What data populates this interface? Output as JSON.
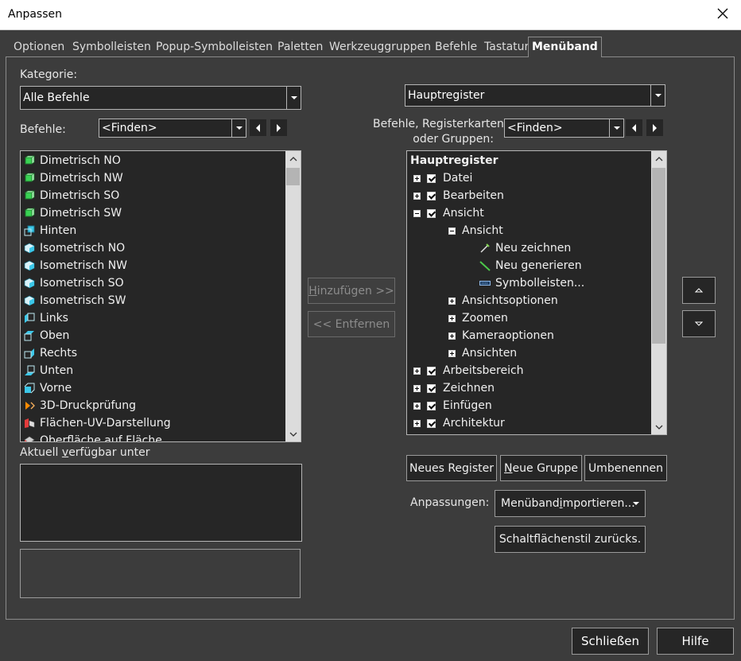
{
  "window": {
    "title": "Anpassen"
  },
  "tabs": [
    {
      "label": "Optionen"
    },
    {
      "label": "Symbolleisten"
    },
    {
      "label": "Popup-Symbolleisten"
    },
    {
      "label": "Paletten"
    },
    {
      "label": "Werkzeuggruppen"
    },
    {
      "label": "Befehle"
    },
    {
      "label": "Tastatur"
    },
    {
      "label": "Menüband",
      "active": true
    }
  ],
  "left": {
    "category_label": "Kategorie:",
    "category_value": "Alle Befehle",
    "commands_label": "Befehle:",
    "find_value": "<Finden>",
    "commands": [
      {
        "label": "Dimetrisch NO",
        "icon": "cube-green-icon"
      },
      {
        "label": "Dimetrisch NW",
        "icon": "cube-green-icon"
      },
      {
        "label": "Dimetrisch SO",
        "icon": "cube-green-icon"
      },
      {
        "label": "Dimetrisch SW",
        "icon": "cube-green-icon"
      },
      {
        "label": "Hinten",
        "icon": "cube-back-icon"
      },
      {
        "label": "Isometrisch NO",
        "icon": "cube-iso-icon"
      },
      {
        "label": "Isometrisch NW",
        "icon": "cube-iso-icon"
      },
      {
        "label": "Isometrisch SO",
        "icon": "cube-iso-icon"
      },
      {
        "label": "Isometrisch SW",
        "icon": "cube-iso-icon"
      },
      {
        "label": "Links",
        "icon": "cube-left-icon"
      },
      {
        "label": "Oben",
        "icon": "cube-top-icon"
      },
      {
        "label": "Rechts",
        "icon": "cube-right-icon"
      },
      {
        "label": "Unten",
        "icon": "cube-bottom-icon"
      },
      {
        "label": "Vorne",
        "icon": "cube-front-icon"
      },
      {
        "label": "3D-Druckprüfung",
        "icon": "print3d-icon"
      },
      {
        "label": "Flächen-UV-Darstellung",
        "icon": "uv-map-icon"
      },
      {
        "label": "Oberfläche auf Fläche",
        "icon": "surface-icon"
      }
    ],
    "available_label_pre": "Aktuell ",
    "available_label_u": "v",
    "available_label_post": "erfügbar unter"
  },
  "middle": {
    "add_button_u": "H",
    "add_button_rest": "inzufügen >>",
    "remove_button": "<< Entfernen"
  },
  "right": {
    "tab_value": "Hauptregister",
    "commands_label_line1": "Befehle, Registerkarten",
    "commands_label_line2": "oder Gruppen:",
    "find_value": "<Finden>",
    "tree": [
      {
        "label": "Hauptregister",
        "level": 0,
        "bold": true
      },
      {
        "label": "Datei",
        "level": 1,
        "expander": "plus",
        "checked": true
      },
      {
        "label": "Bearbeiten",
        "level": 1,
        "expander": "plus",
        "checked": true
      },
      {
        "label": "Ansicht",
        "level": 1,
        "expander": "minus",
        "checked": true
      },
      {
        "label": "Ansicht",
        "level": 2,
        "expander": "minus"
      },
      {
        "label": "Neu zeichnen",
        "level": 3,
        "icon": "redraw-icon"
      },
      {
        "label": "Neu generieren",
        "level": 3,
        "icon": "regen-icon"
      },
      {
        "label": "Symbolleisten...",
        "level": 3,
        "icon": "toolbar-icon"
      },
      {
        "label": "Ansichtsoptionen",
        "level": 2,
        "expander": "plus"
      },
      {
        "label": "Zoomen",
        "level": 2,
        "expander": "plus"
      },
      {
        "label": "Kameraoptionen",
        "level": 2,
        "expander": "plus"
      },
      {
        "label": "Ansichten",
        "level": 2,
        "expander": "plus"
      },
      {
        "label": "Arbeitsbereich",
        "level": 1,
        "expander": "plus",
        "checked": true
      },
      {
        "label": "Zeichnen",
        "level": 1,
        "expander": "plus",
        "checked": true
      },
      {
        "label": "Einfügen",
        "level": 1,
        "expander": "plus",
        "checked": true
      },
      {
        "label": "Architektur",
        "level": 1,
        "expander": "plus",
        "checked": true
      }
    ],
    "new_tab_button": "Neues Register",
    "new_group_u": "N",
    "new_group_rest": "eue Gruppe",
    "rename_button": "Umbenennen",
    "customizations_label": "Anpassungen:",
    "import_pre": "Menüband ",
    "import_u": "i",
    "import_post": "mportieren...",
    "reset_button": "Schaltflächenstil zurücks."
  },
  "footer": {
    "close_button": "Schließen",
    "help_button": "Hilfe"
  }
}
